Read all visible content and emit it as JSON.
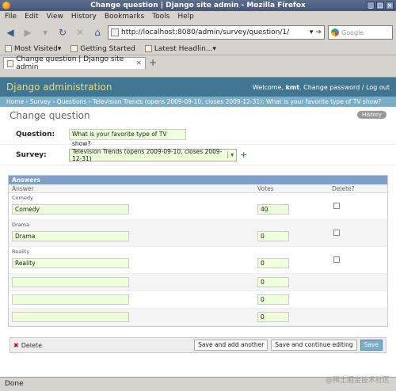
{
  "window": {
    "title": "Change question | Django site admin - Mozilla Firefox",
    "controls": [
      "_",
      "□",
      "×"
    ]
  },
  "menu": [
    "File",
    "Edit",
    "View",
    "History",
    "Bookmarks",
    "Tools",
    "Help"
  ],
  "nav": {
    "url": "http://localhost:8080/admin/survey/question/1/",
    "search_placeholder": "Google"
  },
  "bookmarks": [
    "Most Visited▾",
    "Getting Started",
    "Latest Headlin...▾"
  ],
  "tab": {
    "label": "Change question | Django site admin",
    "close": "×",
    "new_tab": "+"
  },
  "admin": {
    "site_title": "Django administration",
    "welcome_prefix": "Welcome, ",
    "username": "kmt",
    "user_links": ". Change password / Log out",
    "breadcrumbs": "Home › Survey › Questions › Television Trends (opens 2009-09-10, closes 2009-12-31): What is your favorite type of TV show?",
    "page_title": "Change question",
    "history": "History"
  },
  "form": {
    "question_label": "Question:",
    "question_value": "What is your favorite type of TV show?",
    "survey_label": "Survey:",
    "survey_value": "Television Trends (opens 2009-09-10, closes 2009-12-31)",
    "add_icon": "+"
  },
  "inline": {
    "title": "Answers",
    "columns": [
      "Answer",
      "Votes",
      "Delete?"
    ],
    "rows": [
      {
        "original": "Comedy",
        "answer": "Comedy",
        "votes": "40"
      },
      {
        "original": "Drama",
        "answer": "Drama",
        "votes": "0"
      },
      {
        "original": "Reality",
        "answer": "Reality",
        "votes": "0"
      },
      {
        "original": "",
        "answer": "",
        "votes": "0"
      },
      {
        "original": "",
        "answer": "",
        "votes": "0"
      },
      {
        "original": "",
        "answer": "",
        "votes": "0"
      }
    ]
  },
  "actions": {
    "delete": "Delete",
    "save_add": "Save and add another",
    "save_continue": "Save and continue editing",
    "save": "Save"
  },
  "status": "Done",
  "watermark": "@稀土掘金技术社区"
}
